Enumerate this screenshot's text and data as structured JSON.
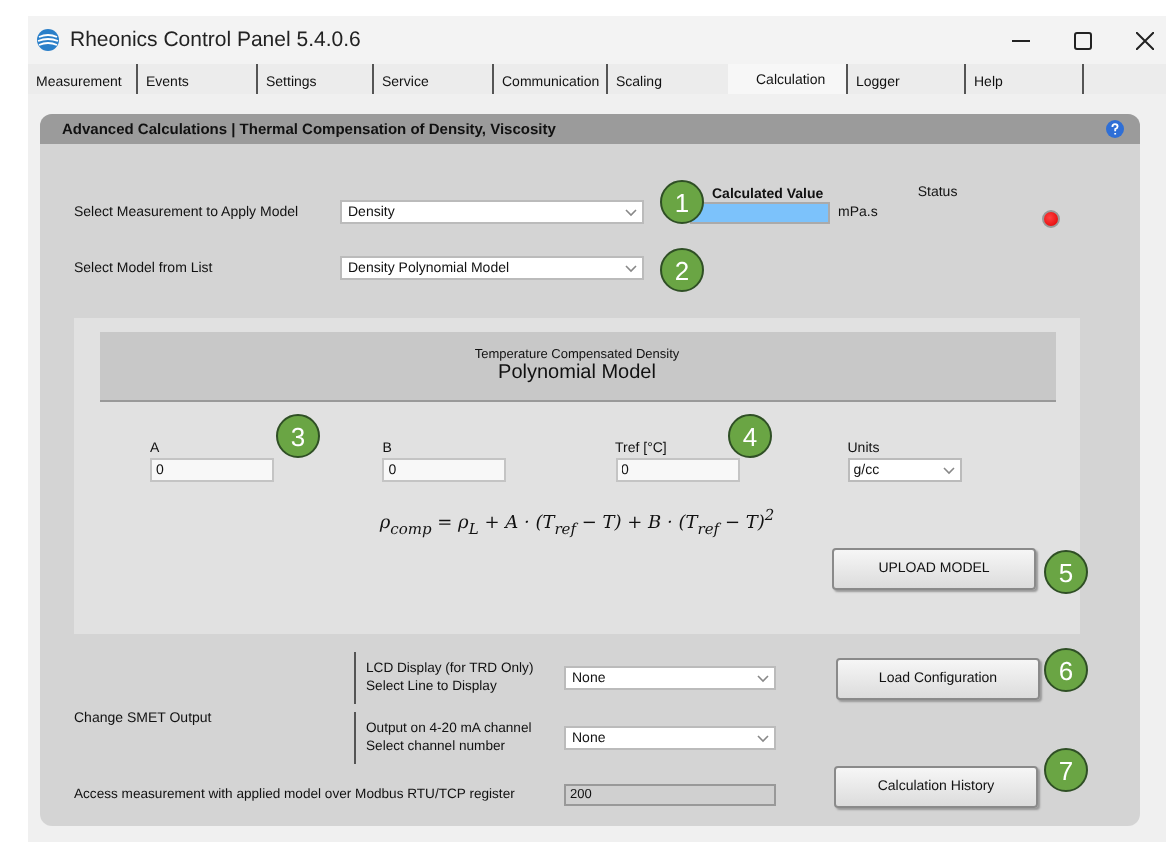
{
  "window": {
    "title": "Rheonics Control Panel 5.4.0.6"
  },
  "tabs": [
    {
      "label": "Measurement",
      "selected": false
    },
    {
      "label": "Events",
      "selected": false
    },
    {
      "label": "Settings",
      "selected": false
    },
    {
      "label": "Service",
      "selected": false
    },
    {
      "label": "Communication",
      "selected": false
    },
    {
      "label": "Scaling",
      "selected": false
    },
    {
      "label": "Calculation",
      "selected": true
    },
    {
      "label": "Logger",
      "selected": false
    },
    {
      "label": "Help",
      "selected": false
    }
  ],
  "panel": {
    "title": "Advanced Calculations | Thermal Compensation of Density, Viscosity"
  },
  "measurement": {
    "label": "Select Measurement to Apply Model",
    "value": "Density"
  },
  "calculated": {
    "label": "Calculated Value",
    "unit": "mPa.s"
  },
  "status": {
    "label": "Status",
    "on": true
  },
  "model": {
    "label": "Select Model from List",
    "value": "Density Polynomial Model"
  },
  "model_panel": {
    "subtitle": "Temperature Compensated Density",
    "title": "Polynomial Model",
    "params": [
      {
        "label": "A",
        "value": "0",
        "kind": "input"
      },
      {
        "label": "B",
        "value": "0",
        "kind": "input"
      },
      {
        "label": "Tref [°C]",
        "value": "0",
        "kind": "input"
      },
      {
        "label": "Units",
        "value": "g/cc",
        "kind": "dropdown"
      }
    ],
    "formula": "ρ$_{comp}$ = ρ$_{L}$ + A · (T$_{ref}$ − T) + B · (T$_{ref}$ − T)$^{2}$",
    "upload_button": "UPLOAD MODEL"
  },
  "smet": {
    "label": "Change SMET Output",
    "outputs": [
      {
        "lines": [
          "LCD Display (for TRD Only)",
          "Select Line to Display"
        ],
        "value": "None"
      },
      {
        "lines": [
          "Output on 4-20 mA channel",
          "Select channel number"
        ],
        "value": "None"
      }
    ]
  },
  "modbus": {
    "label": "Access measurement with applied model over Modbus RTU/TCP register",
    "value": "200"
  },
  "load_button": "Load Configuration",
  "history_button": "Calculation History",
  "callouts": [
    "1",
    "2",
    "3",
    "4",
    "5",
    "6",
    "7"
  ]
}
